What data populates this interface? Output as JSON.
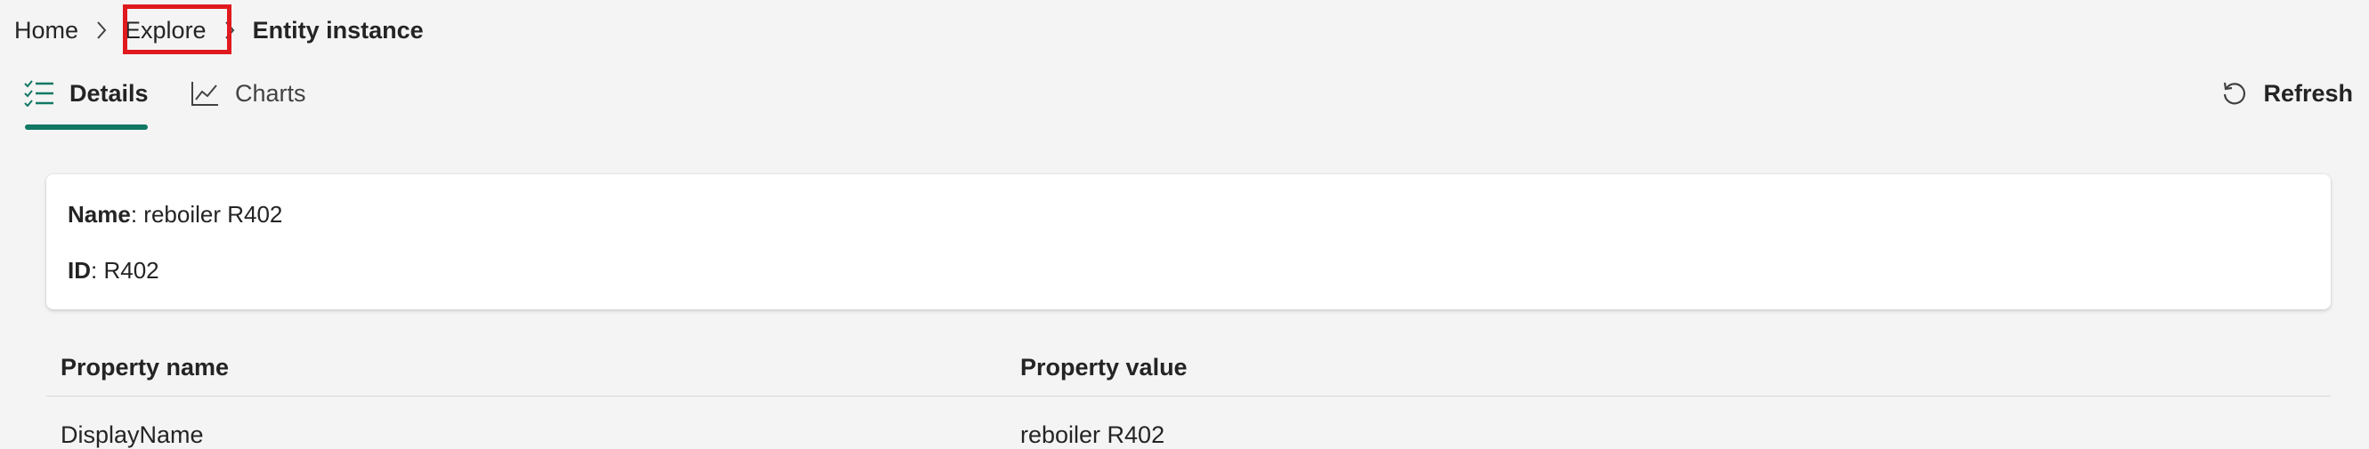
{
  "breadcrumb": {
    "items": [
      {
        "label": "Home"
      },
      {
        "label": "Explore"
      },
      {
        "label": "Entity instance"
      }
    ]
  },
  "tabs": [
    {
      "label": "Details",
      "icon": "checklist-icon",
      "selected": true
    },
    {
      "label": "Charts",
      "icon": "line-chart-icon",
      "selected": false
    }
  ],
  "toolbar": {
    "refresh_label": "Refresh",
    "refresh_icon": "refresh-icon"
  },
  "entity": {
    "name_label": "Name",
    "name_value": "reboiler R402",
    "id_label": "ID",
    "id_value": "R402"
  },
  "table": {
    "columns": [
      "Property name",
      "Property value"
    ],
    "rows": [
      {
        "name": "DisplayName",
        "value": "reboiler R402"
      }
    ]
  },
  "colors": {
    "accent": "#117865",
    "highlight": "#e0191f",
    "background": "#f4f4f4"
  }
}
